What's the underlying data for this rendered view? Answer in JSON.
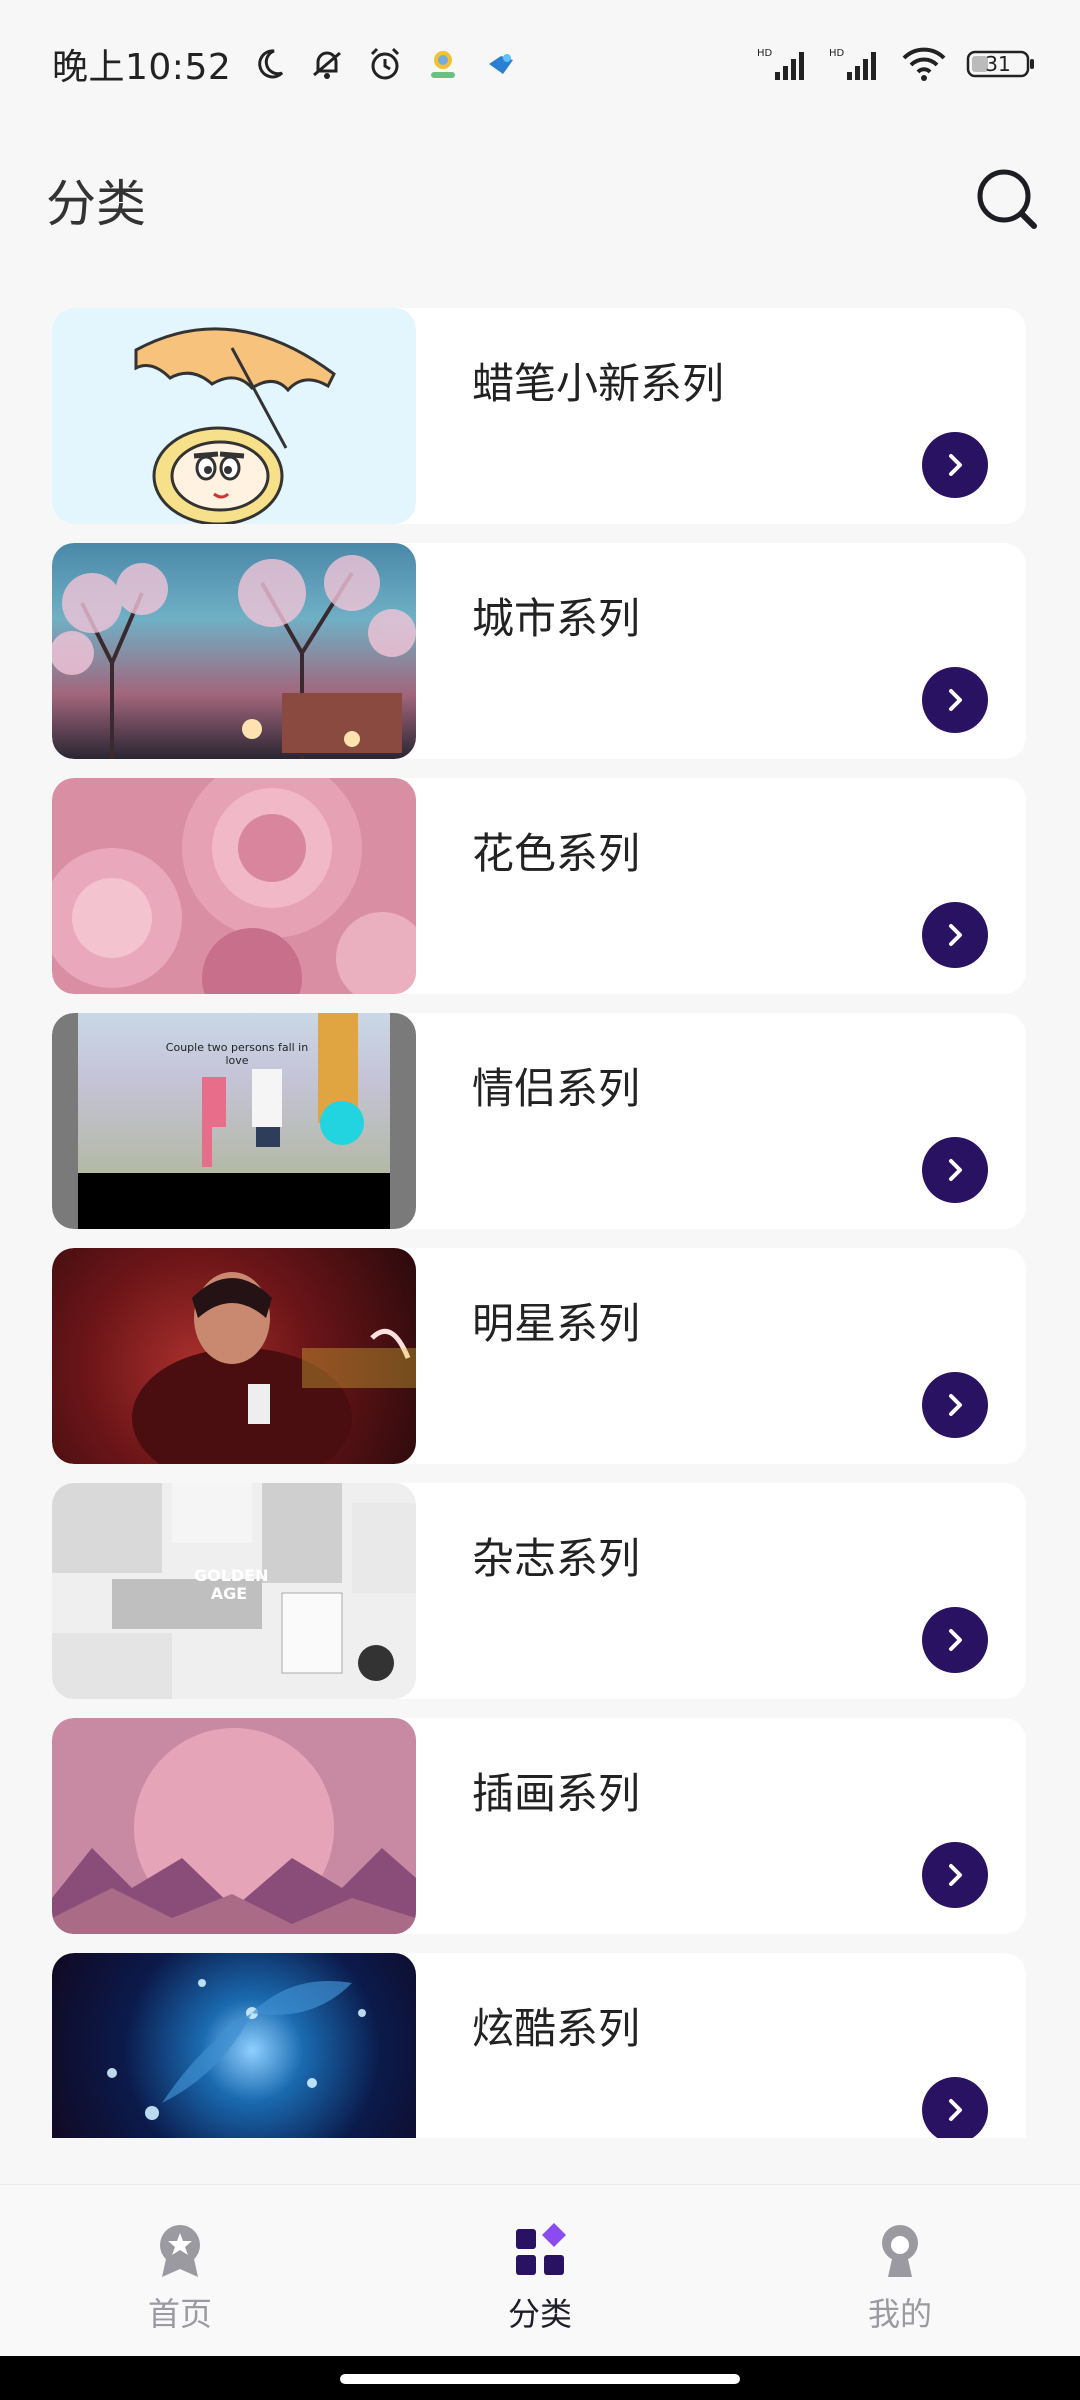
{
  "status_bar": {
    "time": "晚上10:52",
    "battery": "31"
  },
  "header": {
    "title": "分类"
  },
  "categories": [
    {
      "label": "蜡笔小新系列"
    },
    {
      "label": "城市系列"
    },
    {
      "label": "花色系列"
    },
    {
      "label": "情侣系列",
      "caption": "Couple two persons fall in love"
    },
    {
      "label": "明星系列"
    },
    {
      "label": "杂志系列",
      "caption": "GOLDEN AGE"
    },
    {
      "label": "插画系列"
    },
    {
      "label": "炫酷系列"
    }
  ],
  "bottom_nav": {
    "items": [
      {
        "label": "首页",
        "icon": "badge-icon"
      },
      {
        "label": "分类",
        "icon": "category-grid-icon",
        "active": true
      },
      {
        "label": "我的",
        "icon": "profile-icon"
      }
    ]
  },
  "colors": {
    "accent": "#2a1263",
    "nav_active": "#2a1263",
    "nav_inactive": "#9a9aa0"
  }
}
